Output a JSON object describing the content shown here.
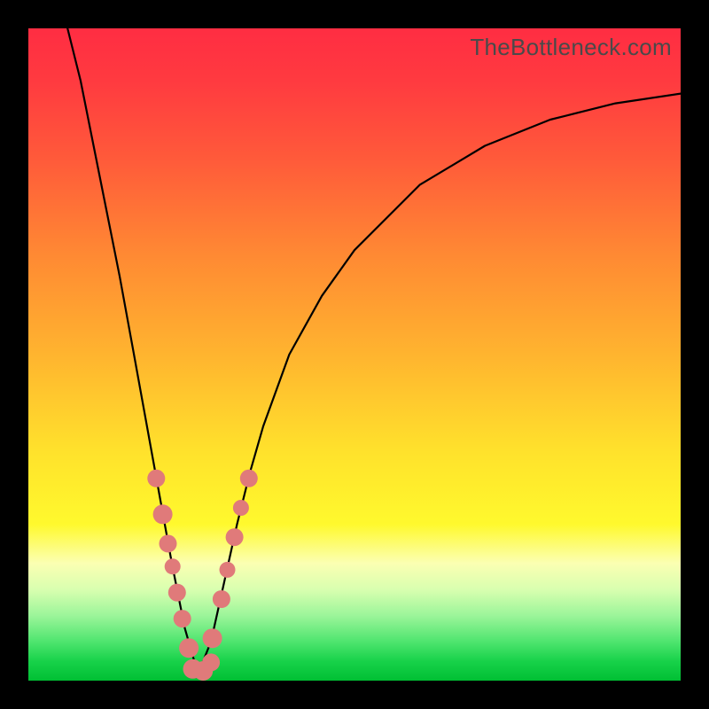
{
  "watermark": "TheBottleneck.com",
  "colors": {
    "frame": "#000000",
    "gradient_top": "#ff2d42",
    "gradient_bottom": "#00bf33",
    "curve": "#000000",
    "marker": "#e07a7a"
  },
  "chart_data": {
    "type": "line",
    "title": "",
    "xlabel": "",
    "ylabel": "",
    "xlim": [
      0,
      1
    ],
    "ylim": [
      0,
      1
    ],
    "notes": "V-shaped bottleneck curve. X and Y are normalized (0–1). Y≈0 at valley near x≈0.26; curve rises steeply on both sides. Salmon markers cluster along the lower portion of both branches near the valley.",
    "series": [
      {
        "name": "bottleneck-curve",
        "x": [
          0.06,
          0.08,
          0.1,
          0.12,
          0.14,
          0.16,
          0.18,
          0.2,
          0.22,
          0.24,
          0.26,
          0.28,
          0.3,
          0.32,
          0.34,
          0.36,
          0.4,
          0.45,
          0.5,
          0.6,
          0.7,
          0.8,
          0.9,
          1.0
        ],
        "y": [
          1.0,
          0.92,
          0.82,
          0.72,
          0.62,
          0.51,
          0.4,
          0.29,
          0.18,
          0.08,
          0.01,
          0.06,
          0.15,
          0.24,
          0.32,
          0.39,
          0.5,
          0.59,
          0.66,
          0.76,
          0.82,
          0.86,
          0.885,
          0.9
        ]
      }
    ],
    "markers": {
      "left_branch": [
        {
          "x": 0.196,
          "y": 0.31,
          "r": 10
        },
        {
          "x": 0.206,
          "y": 0.255,
          "r": 11
        },
        {
          "x": 0.214,
          "y": 0.21,
          "r": 10
        },
        {
          "x": 0.221,
          "y": 0.175,
          "r": 9
        },
        {
          "x": 0.228,
          "y": 0.135,
          "r": 10
        },
        {
          "x": 0.236,
          "y": 0.095,
          "r": 10
        },
        {
          "x": 0.246,
          "y": 0.05,
          "r": 11
        }
      ],
      "right_branch": [
        {
          "x": 0.282,
          "y": 0.065,
          "r": 11
        },
        {
          "x": 0.296,
          "y": 0.125,
          "r": 10
        },
        {
          "x": 0.305,
          "y": 0.17,
          "r": 9
        },
        {
          "x": 0.316,
          "y": 0.22,
          "r": 10
        },
        {
          "x": 0.326,
          "y": 0.265,
          "r": 9
        },
        {
          "x": 0.338,
          "y": 0.31,
          "r": 10
        }
      ],
      "valley": [
        {
          "x": 0.252,
          "y": 0.018,
          "r": 11
        },
        {
          "x": 0.268,
          "y": 0.015,
          "r": 11
        },
        {
          "x": 0.28,
          "y": 0.028,
          "r": 10
        }
      ]
    }
  }
}
